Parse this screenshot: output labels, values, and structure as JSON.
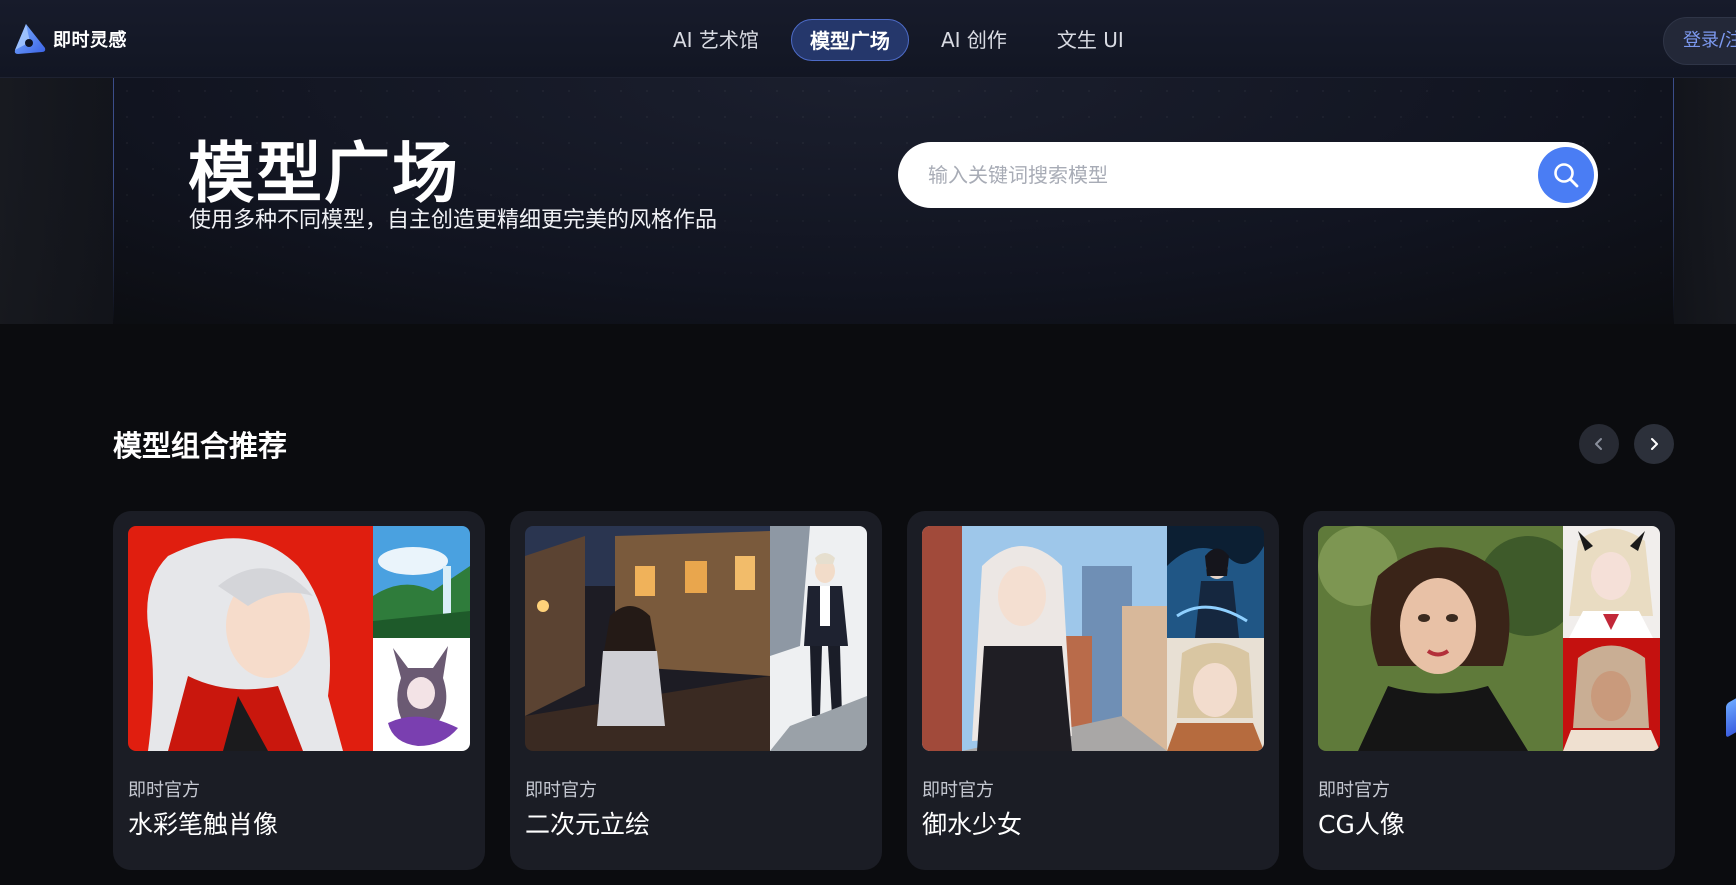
{
  "header": {
    "logo_text": "即时灵感",
    "nav": [
      {
        "label": "AI 艺术馆",
        "active": false
      },
      {
        "label": "模型广场",
        "active": true
      },
      {
        "label": "AI 创作",
        "active": false
      },
      {
        "label": "文生 UI",
        "active": false
      }
    ],
    "login_label": "登录/注册"
  },
  "hero": {
    "title": "模型广场",
    "subtitle": "使用多种不同模型，自主创造更精细更完美的风格作品",
    "search_placeholder": "输入关键词搜索模型"
  },
  "section": {
    "title": "模型组合推荐"
  },
  "cards": [
    {
      "author": "即时官方",
      "name": "水彩笔触肖像"
    },
    {
      "author": "即时官方",
      "name": "二次元立绘"
    },
    {
      "author": "即时官方",
      "name": "御水少女"
    },
    {
      "author": "即时官方",
      "name": "CG人像"
    }
  ],
  "colors": {
    "accent": "#4a7df4",
    "nav_active_bg": "#25376b",
    "card_bg": "#1b1d25",
    "page_bg": "#0b0c0f"
  }
}
